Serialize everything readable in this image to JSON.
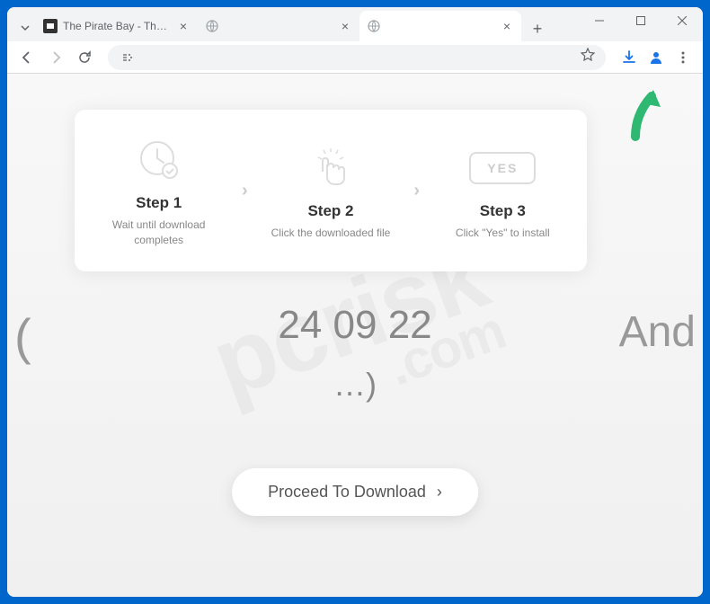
{
  "tabs": [
    {
      "title": "The Pirate Bay - The gala",
      "active": false
    },
    {
      "title": "",
      "active": false
    },
    {
      "title": "",
      "active": true
    }
  ],
  "steps": [
    {
      "title": "Step 1",
      "desc": "Wait until download completes"
    },
    {
      "title": "Step 2",
      "desc": "Click the downloaded file"
    },
    {
      "title": "Step 3",
      "desc": "Click \"Yes\" to install"
    }
  ],
  "yes_label": "YES",
  "big_numbers": "24 09 22",
  "ellipsis": "…)",
  "paren_left": "(",
  "and_text": "And",
  "proceed_label": "Proceed To Download",
  "watermark": {
    "main": "pcrisk",
    "sub": ".com"
  }
}
